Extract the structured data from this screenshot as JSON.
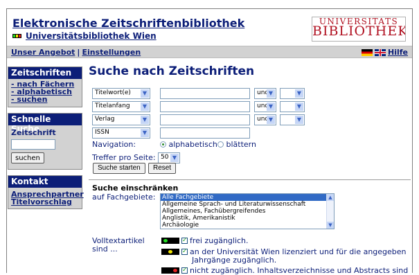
{
  "header": {
    "title": "Elektronische Zeitschriftenbibliothek",
    "subtitle": "Universitätsbibliothek Wien",
    "logo_line1": "UNIVERSITÄTS",
    "logo_line2": "BIBLIOTHEK"
  },
  "menu": {
    "angebot": "Unser Angebot",
    "separator": "|",
    "einstellungen": "Einstellungen",
    "hilfe": "Hilfe"
  },
  "sidebar": {
    "zeitschriften_title": "Zeitschriften",
    "links": [
      "- nach Fächern",
      "- alphabetisch",
      "- suchen"
    ],
    "schnelle_suche_title": "Schnelle Suche",
    "zeitschrift_label": "Zeitschrift",
    "suchen_button": "suchen",
    "kontakt_title": "Kontakt",
    "kontakt_links": [
      "Ansprechpartner",
      "Titelvorschlag"
    ]
  },
  "search": {
    "heading": "Suche nach Zeitschriften",
    "fields": [
      "Titelwort(e)",
      "Titelanfang",
      "Verlag",
      "ISSN"
    ],
    "connector": "und",
    "navigation_label": "Navigation:",
    "nav_alpha": "alphabetisch",
    "nav_blaettern": "blättern",
    "treffer_label": "Treffer pro Seite:",
    "treffer_value": "50",
    "start_button": "Suche starten",
    "reset_button": "Reset"
  },
  "restrict": {
    "heading": "Suche einschränken",
    "fachgebiete_label": "auf Fachgebiete:",
    "fachgebiete": [
      "Alle Fachgebiete",
      "Allgemeine Sprach- und Literaturwissenschaft",
      "Allgemeines, Fachübergreifendes",
      "Anglistik, Amerikanistik",
      "Archäologie"
    ],
    "volltext_label_1": "Volltextartikel",
    "volltext_label_2": "sind ...",
    "options": [
      "frei zugänglich.",
      "an der Universität Wien lizenziert und für die angegeben",
      "Jahrgänge zugänglich.",
      "nicht zugänglich. Inhaltsverzeichnisse und Abstracts sind"
    ]
  },
  "colors": {
    "brand_blue": "#0c1e78",
    "logo_red": "#b01020",
    "light_green": "#22dd22",
    "yellow": "#f2e600",
    "red": "#e02020"
  }
}
